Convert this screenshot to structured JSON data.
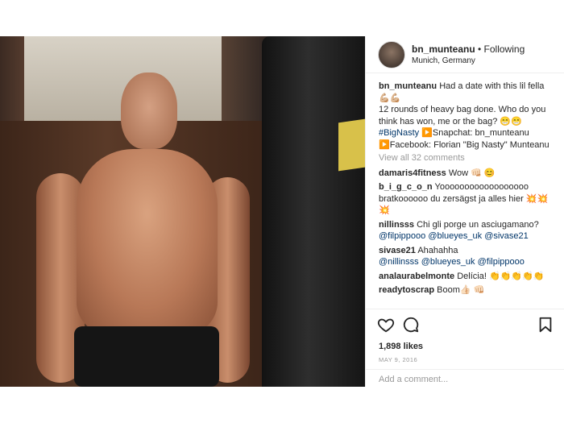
{
  "post": {
    "username": "bn_munteanu",
    "separator": " • ",
    "follow_status": "Following",
    "location": "Munich, Germany"
  },
  "caption": {
    "username": "bn_munteanu",
    "line1": "Had a date with this lil fella 💪🏼💪🏼",
    "line2": "12 rounds of heavy bag done. Who do you think has won, me or the bag? 😁😁",
    "hashtag": "#BigNasty",
    "snapchat": "▶️Snapchat: bn_munteanu",
    "facebook": "▶️Facebook: Florian \"Big Nasty\" Munteanu"
  },
  "view_all": "View all 32 comments",
  "comments": [
    {
      "user": "damaris4fitness",
      "text": "Wow 👊🏻 😊",
      "mentions": ""
    },
    {
      "user": "b_i_g_c_o_n",
      "text": "Yoooooooooooooooooo bratkoooooo du zersägst ja alles hier 💥💥💥",
      "mentions": ""
    },
    {
      "user": "nillinsss",
      "text": "Chi gli porge un asciugamano?",
      "mentions": "@filpippooo @blueyes_uk @sivase21"
    },
    {
      "user": "sivase21",
      "text": "Ahahahha",
      "mentions": "@nillinsss @blueyes_uk @filpippooo"
    },
    {
      "user": "analaurabelmonte",
      "text": "Delícia! 👏👏👏👏👏",
      "mentions": ""
    },
    {
      "user": "readytoscrap",
      "text": "Boom👍🏻 👊🏻",
      "mentions": ""
    }
  ],
  "likes": "1,898 likes",
  "date": "MAY 9, 2016",
  "add_comment_placeholder": "Add a comment...",
  "icons": {
    "like": "heart-icon",
    "comment": "comment-bubble-icon",
    "save": "bookmark-icon"
  },
  "colors": {
    "text": "#262626",
    "muted": "#999999",
    "link": "#003569",
    "border": "#efefef"
  }
}
